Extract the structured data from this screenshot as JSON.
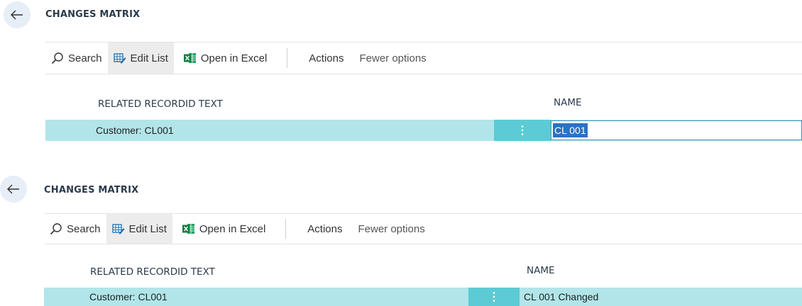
{
  "panels": [
    {
      "title": "CHANGES MATRIX",
      "toolbar": {
        "search": "Search",
        "edit_list": "Edit List",
        "open_excel": "Open in Excel",
        "actions": "Actions",
        "fewer": "Fewer options"
      },
      "columns": [
        "RELATED RECORDID TEXT",
        "NAME"
      ],
      "row": {
        "related": "Customer: CL001",
        "name": "CL 001"
      }
    },
    {
      "title": "CHANGES MATRIX",
      "toolbar": {
        "search": "Search",
        "edit_list": "Edit List",
        "open_excel": "Open in Excel",
        "actions": "Actions",
        "fewer": "Fewer options"
      },
      "columns": [
        "RELATED RECORDID TEXT",
        "NAME"
      ],
      "row": {
        "related": "Customer: CL001",
        "name": "CL 001 Changed"
      }
    }
  ],
  "colors": {
    "row": "#b1e5e9",
    "row_menu": "#5ccbd5",
    "selection": "#2a72c5"
  },
  "icons": [
    "back-arrow-icon",
    "search-icon",
    "edit-list-icon",
    "excel-icon",
    "row-menu-icon"
  ]
}
